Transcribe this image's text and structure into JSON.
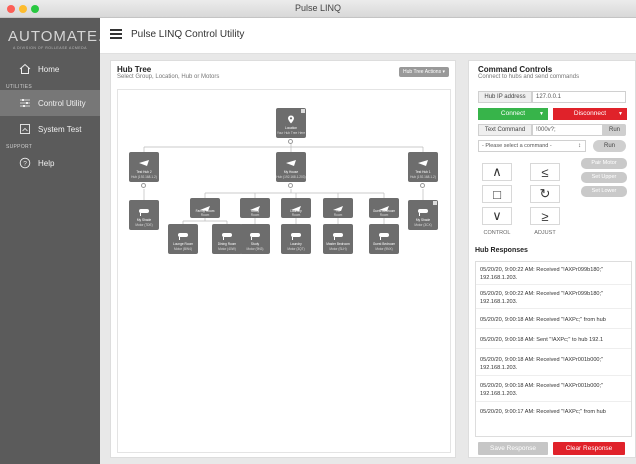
{
  "window": {
    "title": "Pulse LINQ"
  },
  "brand": {
    "logo": "AUTOMATE.",
    "tagline": "A DIVISION OF ROLLEASE ACMEDA"
  },
  "sidebar": {
    "home": "Home",
    "section_utilities": "UTILITIES",
    "control_utility": "Control Utility",
    "system_test": "System Test",
    "section_support": "SUPPORT",
    "help": "Help"
  },
  "header": {
    "title": "Pulse LINQ Control Utility"
  },
  "hub_tree": {
    "title": "Hub Tree",
    "subtitle": "Select Group, Location, Hub or Motors",
    "actions_button": "Hub Tree Actions ▾",
    "nodes": {
      "location": {
        "label": "Location",
        "sub": "Your Hub Tree Here"
      },
      "hub2": {
        "label": "Test Hub 2",
        "sub": "Hub (192.168.1.2)"
      },
      "myhouse": {
        "label": "My House",
        "sub": "Hub (192.168.1.203)"
      },
      "hub1": {
        "label": "Test Hub 1",
        "sub": "Hub (192.168.1.2)"
      },
      "myshade1": {
        "label": "My Shade",
        "sub": "Motor (7DE)"
      },
      "familyroom": {
        "label": "Family Room",
        "sub": "Room"
      },
      "study": {
        "label": "Study",
        "sub": "Room"
      },
      "laundry": {
        "label": "Laundry",
        "sub": "Room"
      },
      "tv": {
        "label": "TV",
        "sub": "Room"
      },
      "guestbed": {
        "label": "Guest Bedroom",
        "sub": "Room"
      },
      "myshade2": {
        "label": "My Shade",
        "sub": "Motor (3CX)"
      },
      "lounge": {
        "label": "Lounge Room",
        "sub": "Motor (BW4)"
      },
      "dining": {
        "label": "Dining Room",
        "sub": "Motor (40W)"
      },
      "study_m": {
        "label": "Study",
        "sub": "Motor (9N3)"
      },
      "laundry_m": {
        "label": "Laundry",
        "sub": "Motor (3QT)"
      },
      "master": {
        "label": "Master Bedroom",
        "sub": "Motor (SLH)"
      },
      "guestbed_m": {
        "label": "Guest Bedroom",
        "sub": "Motor (9NX)"
      }
    }
  },
  "command": {
    "title": "Command Controls",
    "subtitle": "Connect to hubs and send commands",
    "hub_ip_label": "Hub IP address",
    "hub_ip_value": "127.0.0.1",
    "connect": "Connect",
    "disconnect": "Disconnect",
    "text_cmd_label": "Text Command",
    "text_cmd_value": "!000v?;",
    "run1": "Run",
    "select_placeholder": "- Please select a command -",
    "select_arrow": "↕",
    "run2": "Run",
    "glyphs": {
      "up": "∧",
      "stop": "□",
      "down": "∨",
      "upper": "≤",
      "refresh": "↻",
      "lower": "≥"
    },
    "control_label": "CONTROL",
    "adjust_label": "ADJUST",
    "pair_motor": "Pair Motor",
    "set_upper": "Set Upper",
    "set_lower": "Set Lower"
  },
  "responses": {
    "title": "Hub Responses",
    "items": [
      "05/20/20, 9:00:22 AM: Received \"!AXPr099b180;\"",
      "192.168.1.203.",
      "05/20/20, 9:00:22 AM: Received \"!AXPr099b180;\"",
      "192.168.1.203.",
      "05/20/20, 9:00:18 AM: Received \"!AXPc;\" from hub",
      "05/20/20, 9:00:18 AM: Sent \"!AXPc;\" to hub 192.1",
      "05/20/20, 9:00:18 AM: Received \"!AXPr001b000;\"",
      "192.168.1.203.",
      "05/20/20, 9:00:18 AM: Received \"!AXPr001b000;\"",
      "192.168.1.203.",
      "05/20/20, 9:00:17 AM: Received \"!AXPc;\" from hub"
    ],
    "save": "Save Response",
    "clear": "Clear Response"
  },
  "colors": {
    "accent_green": "#37b44a",
    "accent_red": "#e0222a",
    "sidebar": "#5b5b5b"
  }
}
